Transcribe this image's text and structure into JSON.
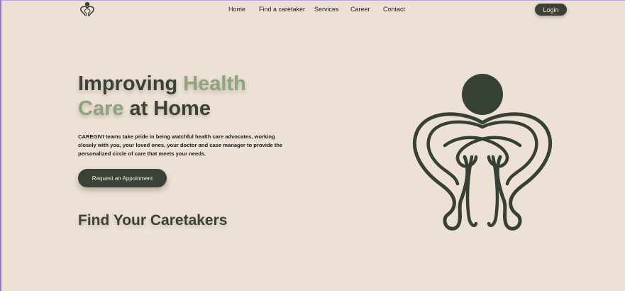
{
  "colors": {
    "background": "#ede0d4",
    "primary": "#3a4237",
    "accent": "#8fa47c",
    "button_text": "#f3ece4"
  },
  "nav": {
    "logo_icon": "caregiver-logo-icon",
    "links": [
      "Home",
      "Find a caretaker",
      "Services",
      "Career",
      "Contact"
    ],
    "login_label": "Login"
  },
  "hero": {
    "title_part1": "Improving ",
    "title_accent": "Health Care",
    "title_part2": " at Home",
    "description": "CAREGIVI teams take pride in being watchful health care advocates, working closely with you, your loved ones, your doctor and case manager to provide the personalized circle of care that meets your needs.",
    "cta_label": "Request an Appoinment",
    "figure_icon": "caregiver-embrace-illustration"
  },
  "section": {
    "title": "Find Your Caretakers"
  }
}
